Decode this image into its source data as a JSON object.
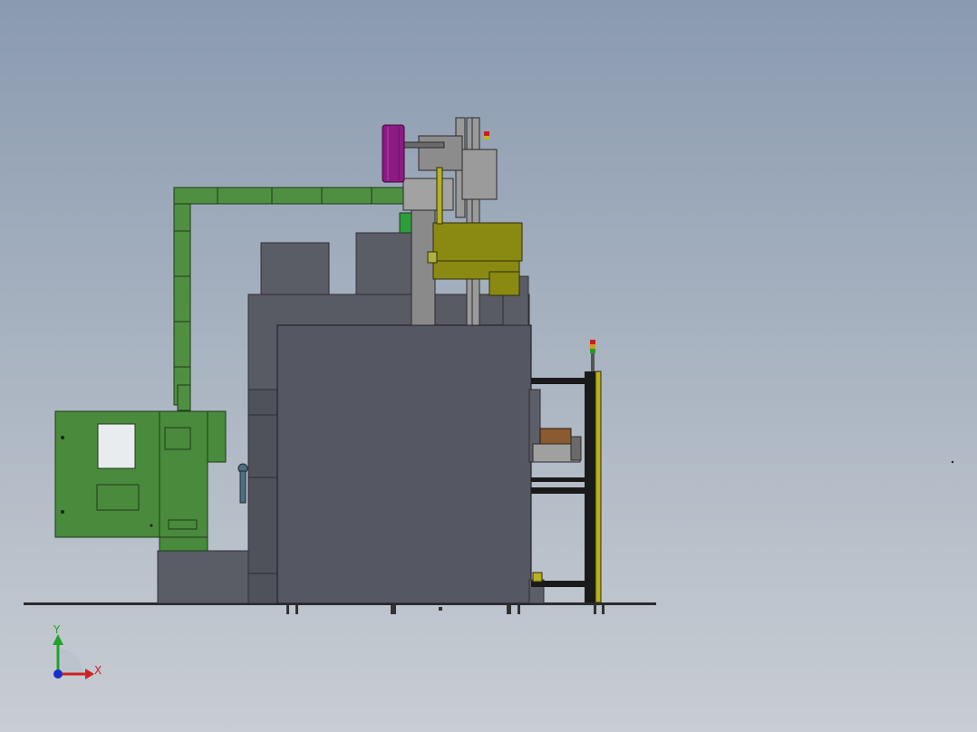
{
  "viewport": {
    "background_top": "#8a9ab0",
    "background_bottom": "#c8cdd3"
  },
  "triad": {
    "y_label": "Y",
    "x_label": "X",
    "y_color": "#21a32a",
    "x_color": "#d02020",
    "z_color": "#1a2fc8"
  },
  "colors": {
    "machine_gray": "#54565f",
    "panel_green": "#4a8a3c",
    "duct_green": "#4f8f42",
    "bracket_olive": "#8a8a12",
    "reel_magenta": "#8e1a86",
    "frame_black": "#1a1a1a",
    "rail_yellow": "#b8b020"
  }
}
